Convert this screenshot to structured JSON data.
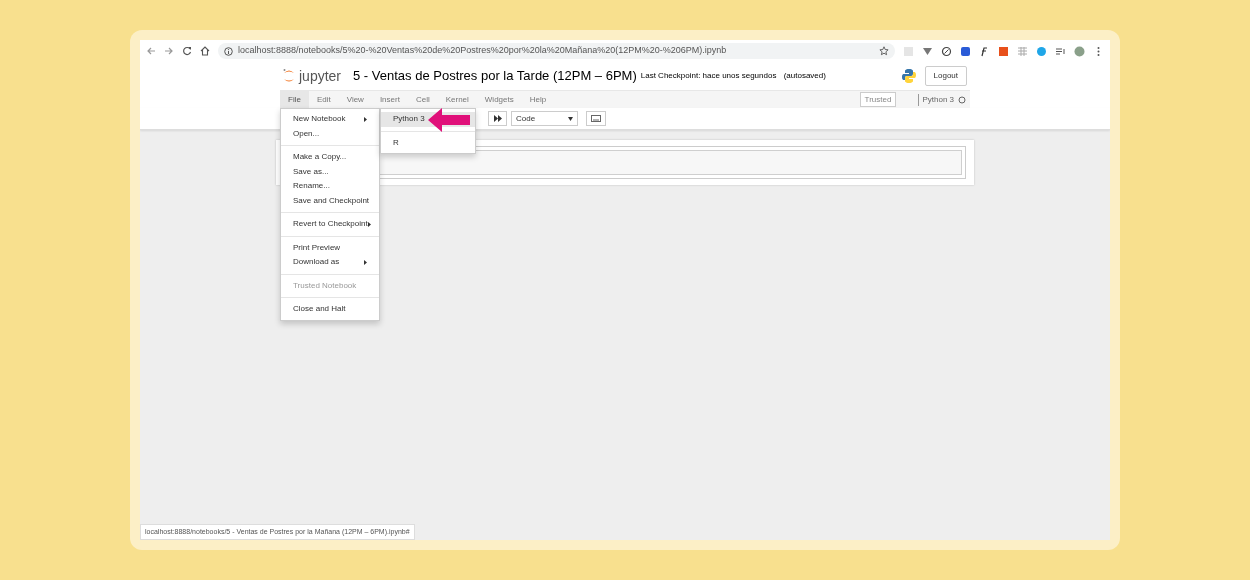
{
  "browser": {
    "url": "localhost:8888/notebooks/5%20-%20Ventas%20de%20Postres%20por%20la%20Mañana%20(12PM%20-%206PM).ipynb"
  },
  "header": {
    "logo_text": "jupyter",
    "notebook_title": "5 - Ventas de Postres por la Tarde (12PM – 6PM)",
    "checkpoint_label": "Last Checkpoint:",
    "checkpoint_time": "hace unos segundos",
    "autosave": "(autosaved)",
    "logout": "Logout"
  },
  "menubar": {
    "items": [
      {
        "label": "File",
        "selected": true
      },
      {
        "label": "Edit",
        "selected": false
      },
      {
        "label": "View",
        "selected": false
      },
      {
        "label": "Insert",
        "selected": false
      },
      {
        "label": "Cell",
        "selected": false
      },
      {
        "label": "Kernel",
        "selected": false
      },
      {
        "label": "Widgets",
        "selected": false
      },
      {
        "label": "Help",
        "selected": false
      }
    ],
    "trusted": "Trusted",
    "kernel": "Python 3"
  },
  "toolbar": {
    "cell_type": "Code"
  },
  "file_menu": {
    "groups": [
      [
        {
          "label": "New Notebook",
          "submenu": true,
          "disabled": false
        },
        {
          "label": "Open...",
          "submenu": false,
          "disabled": false
        }
      ],
      [
        {
          "label": "Make a Copy...",
          "submenu": false,
          "disabled": false
        },
        {
          "label": "Save as...",
          "submenu": false,
          "disabled": false
        },
        {
          "label": "Rename...",
          "submenu": false,
          "disabled": false
        },
        {
          "label": "Save and Checkpoint",
          "submenu": false,
          "disabled": false
        }
      ],
      [
        {
          "label": "Revert to Checkpoint",
          "submenu": true,
          "disabled": false
        }
      ],
      [
        {
          "label": "Print Preview",
          "submenu": false,
          "disabled": false
        },
        {
          "label": "Download as",
          "submenu": true,
          "disabled": false
        }
      ],
      [
        {
          "label": "Trusted Notebook",
          "submenu": false,
          "disabled": true
        }
      ],
      [
        {
          "label": "Close and Halt",
          "submenu": false,
          "disabled": false
        }
      ]
    ]
  },
  "new_notebook_menu": {
    "groups": [
      [
        {
          "label": "Python 3",
          "selected": true
        }
      ],
      [
        {
          "label": "R",
          "selected": false
        }
      ]
    ]
  },
  "status_url": "localhost:8888/notebooks/5 - Ventas de Postres por la Mañana (12PM – 6PM).ipynb#"
}
